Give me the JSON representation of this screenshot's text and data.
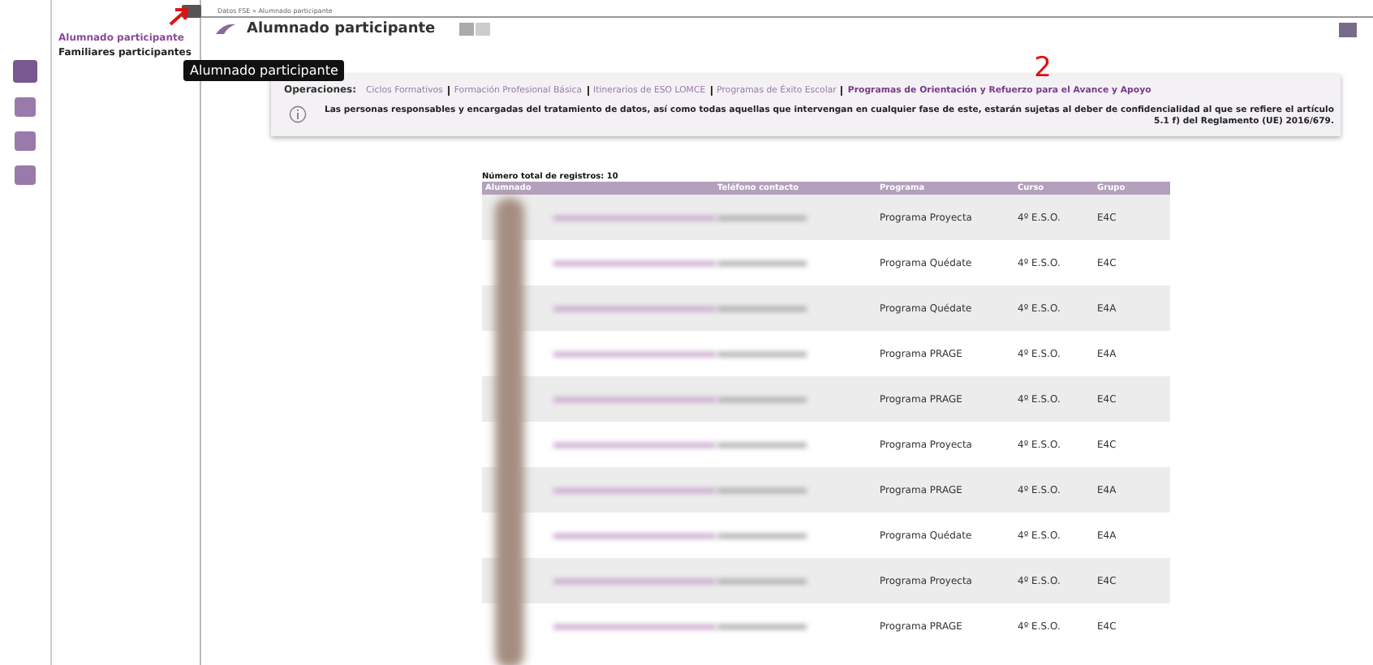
{
  "breadcrumb": "Datos FSE » Alumnado participante",
  "page_title": "Alumnado participante",
  "side_menu": [
    {
      "label": "Alumnado participante",
      "selected": true
    },
    {
      "label": "Familiares participantes",
      "selected": false
    }
  ],
  "tooltip": "Alumnado participante",
  "annotations": [
    "2"
  ],
  "operations": {
    "label": "Operaciones:",
    "links": [
      {
        "label": "Ciclos Formativos",
        "selected": false
      },
      {
        "label": "Formación Profesional Básica",
        "selected": false
      },
      {
        "label": "Itinerarios de ESO LOMCE",
        "selected": false
      },
      {
        "label": "Programas de Éxito Escolar",
        "selected": false
      },
      {
        "label": "Programas de Orientación y Refuerzo para el Avance y Apoyo",
        "selected": true
      }
    ],
    "notice": "Las personas responsables y encargadas del tratamiento de datos, así como todas aquellas que intervengan en cualquier fase de este, estarán sujetas al deber de confidencialidad al que se refiere el artículo 5.1 f) del Reglamento (UE) 2016/679."
  },
  "table": {
    "count": "Número total de registros: 10",
    "columns": [
      "Alumnado",
      "Teléfono contacto",
      "Programa",
      "Curso",
      "Grupo"
    ],
    "rows": [
      {
        "programa": "Programa Proyecta",
        "curso": "4º E.S.O.",
        "grupo": "E4C"
      },
      {
        "programa": "Programa Quédate",
        "curso": "4º E.S.O.",
        "grupo": "E4C"
      },
      {
        "programa": "Programa Quédate",
        "curso": "4º E.S.O.",
        "grupo": "E4A"
      },
      {
        "programa": "Programa PRAGE",
        "curso": "4º E.S.O.",
        "grupo": "E4A"
      },
      {
        "programa": "Programa PRAGE",
        "curso": "4º E.S.O.",
        "grupo": "E4C"
      },
      {
        "programa": "Programa Proyecta",
        "curso": "4º E.S.O.",
        "grupo": "E4C"
      },
      {
        "programa": "Programa PRAGE",
        "curso": "4º E.S.O.",
        "grupo": "E4A"
      },
      {
        "programa": "Programa Quédate",
        "curso": "4º E.S.O.",
        "grupo": "E4A"
      },
      {
        "programa": "Programa Proyecta",
        "curso": "4º E.S.O.",
        "grupo": "E4C"
      },
      {
        "programa": "Programa PRAGE",
        "curso": "4º E.S.O.",
        "grupo": "E4C"
      }
    ]
  }
}
